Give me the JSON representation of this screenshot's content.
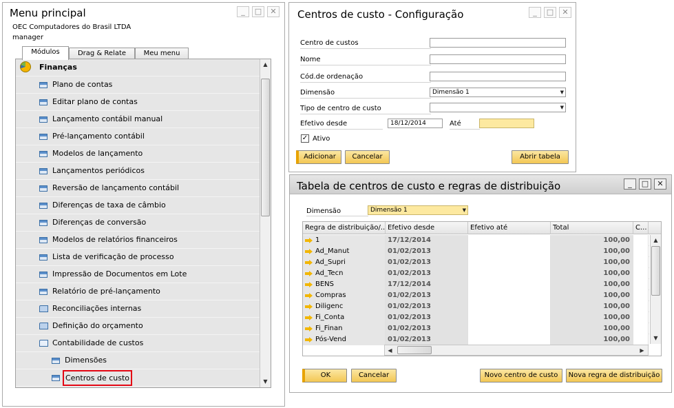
{
  "menu_principal": {
    "title": "Menu principal",
    "company": "OEC Computadores do Brasil LTDA",
    "user": "manager",
    "tabs": [
      "Módulos",
      "Drag & Relate",
      "Meu menu"
    ],
    "section": "Finanças",
    "items": [
      "Plano de contas",
      "Editar plano de contas",
      "Lançamento contábil manual",
      "Pré-lançamento contábil",
      "Modelos de lançamento",
      "Lançamentos periódicos",
      "Reversão de lançamento contábil",
      "Diferenças de taxa de câmbio",
      "Diferenças de conversão",
      "Modelos de relatórios financeiros",
      "Lista de verificação de processo",
      "Impressão de Documentos em Lote",
      "Relatório de pré-lançamento",
      "Reconciliações internas",
      "Definição do orçamento",
      "Contabilidade de custos",
      "Dimensões",
      "Centros de custo"
    ]
  },
  "config": {
    "title": "Centros de custo - Configuração",
    "labels": {
      "centro": "Centro de custos",
      "nome": "Nome",
      "cod": "Cód.de ordenação",
      "dimensao": "Dimensão",
      "tipo": "Tipo de centro de custo",
      "efetivo": "Efetivo desde",
      "ate": "Até",
      "ativo": "Ativo"
    },
    "values": {
      "centro": "",
      "nome": "",
      "cod": "",
      "dimensao": "Dimensão 1",
      "tipo": "",
      "efetivo": "18/12/2014",
      "ate": ""
    },
    "buttons": {
      "adicionar": "Adicionar",
      "cancelar": "Cancelar",
      "abrir": "Abrir tabela"
    }
  },
  "tabela": {
    "title": "Tabela de centros de custo e regras de distribuição",
    "dimensao_label": "Dimensão",
    "dimensao_value": "Dimensão 1",
    "columns": [
      "Regra de distribuição/...",
      "Efetivo desde",
      "Efetivo até",
      "Total",
      "C..."
    ],
    "rows": [
      {
        "regra": "1",
        "desde": "17/12/2014",
        "ate": "",
        "total": "100,00"
      },
      {
        "regra": "Ad_Manut",
        "desde": "01/02/2013",
        "ate": "",
        "total": "100,00"
      },
      {
        "regra": "Ad_Supri",
        "desde": "01/02/2013",
        "ate": "",
        "total": "100,00"
      },
      {
        "regra": "Ad_Tecn",
        "desde": "01/02/2013",
        "ate": "",
        "total": "100,00"
      },
      {
        "regra": "BENS",
        "desde": "17/12/2014",
        "ate": "",
        "total": "100,00"
      },
      {
        "regra": "Compras",
        "desde": "01/02/2013",
        "ate": "",
        "total": "100,00"
      },
      {
        "regra": "Diligenc",
        "desde": "01/02/2013",
        "ate": "",
        "total": "100,00"
      },
      {
        "regra": "Fi_Conta",
        "desde": "01/02/2013",
        "ate": "",
        "total": "100,00"
      },
      {
        "regra": "Fi_Finan",
        "desde": "01/02/2013",
        "ate": "",
        "total": "100,00"
      },
      {
        "regra": "Pós-Vend",
        "desde": "01/02/2013",
        "ate": "",
        "total": "100,00"
      }
    ],
    "buttons": {
      "ok": "OK",
      "cancelar": "Cancelar",
      "novo": "Novo centro de custo",
      "nova_regra": "Nova regra de distribuição"
    }
  }
}
